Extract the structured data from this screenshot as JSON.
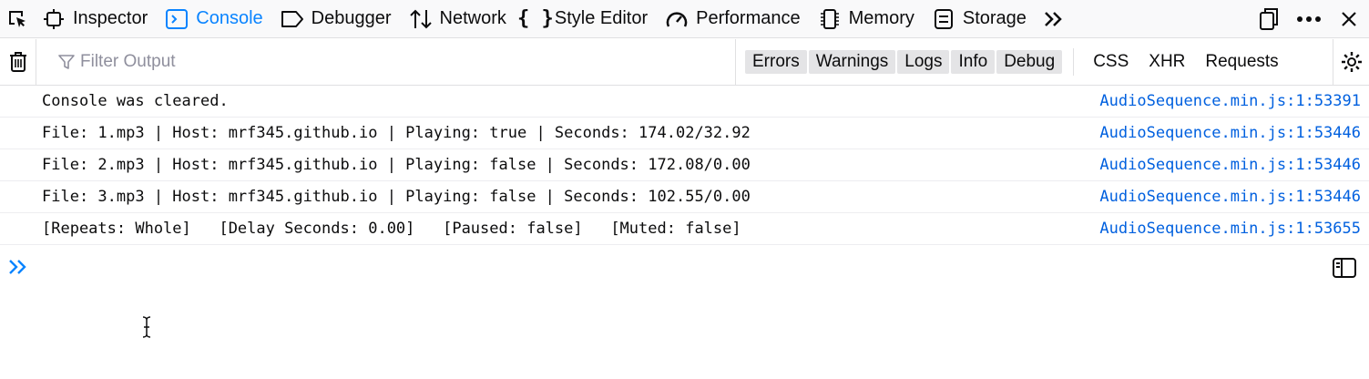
{
  "toolbar": {
    "tabs": [
      {
        "label": "Inspector",
        "icon": "inspector-icon"
      },
      {
        "label": "Console",
        "icon": "console-icon",
        "selected": true
      },
      {
        "label": "Debugger",
        "icon": "debugger-icon"
      },
      {
        "label": "Network",
        "icon": "network-icon"
      },
      {
        "label": "Style Editor",
        "icon": "style-editor-icon"
      },
      {
        "label": "Performance",
        "icon": "performance-icon"
      },
      {
        "label": "Memory",
        "icon": "memory-icon"
      },
      {
        "label": "Storage",
        "icon": "storage-icon"
      }
    ],
    "accent_color": "#0a84ff"
  },
  "filterbar": {
    "placeholder": "Filter Output",
    "levels": [
      "Errors",
      "Warnings",
      "Logs",
      "Info",
      "Debug"
    ],
    "types": [
      "CSS",
      "XHR",
      "Requests"
    ]
  },
  "messages": [
    {
      "text": "Console was cleared.",
      "location": "AudioSequence.min.js:1:53391"
    },
    {
      "text": "File: 1.mp3 | Host: mrf345.github.io | Playing: true | Seconds: 174.02/32.92",
      "location": "AudioSequence.min.js:1:53446"
    },
    {
      "text": "File: 2.mp3 | Host: mrf345.github.io | Playing: false | Seconds: 172.08/0.00",
      "location": "AudioSequence.min.js:1:53446"
    },
    {
      "text": "File: 3.mp3 | Host: mrf345.github.io | Playing: false | Seconds: 102.55/0.00",
      "location": "AudioSequence.min.js:1:53446"
    },
    {
      "text": "[Repeats: Whole]   [Delay Seconds: 0.00]   [Paused: false]   [Muted: false]",
      "location": "AudioSequence.min.js:1:53655"
    }
  ],
  "link_color": "#0060df"
}
